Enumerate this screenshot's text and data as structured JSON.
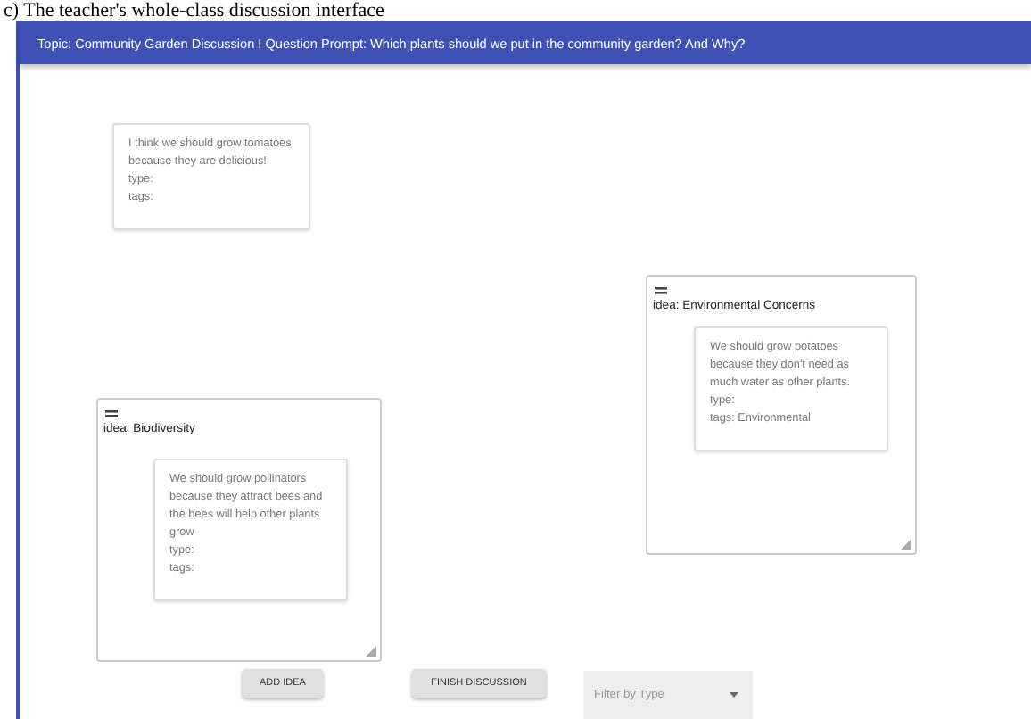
{
  "caption": "c) The teacher's whole-class discussion interface",
  "header": {
    "title": "Topic: Community Garden Discussion I Question Prompt: Which plants should we put in the community garden? And Why?"
  },
  "notes": [
    {
      "text": "I think we should grow tomatoes because they are delicious!",
      "type_line": "type:",
      "tags_line": "tags:"
    }
  ],
  "ideas": [
    {
      "title": "idea: Environmental Concerns",
      "notes": [
        {
          "text": "We should grow potatoes because they don't need as much water as other plants.",
          "type_line": "type:",
          "tags_line": "tags: Environmental"
        }
      ]
    },
    {
      "title": "idea: Biodiversity",
      "notes": [
        {
          "text": "We should grow pollinators because they attract bees and the bees will help other plants grow",
          "type_line": "type:",
          "tags_line": "tags:"
        }
      ]
    }
  ],
  "buttons": [
    "ADD IDEA",
    "FINISH DISCUSSION"
  ],
  "filter": {
    "placeholder": "Filter by Type"
  }
}
